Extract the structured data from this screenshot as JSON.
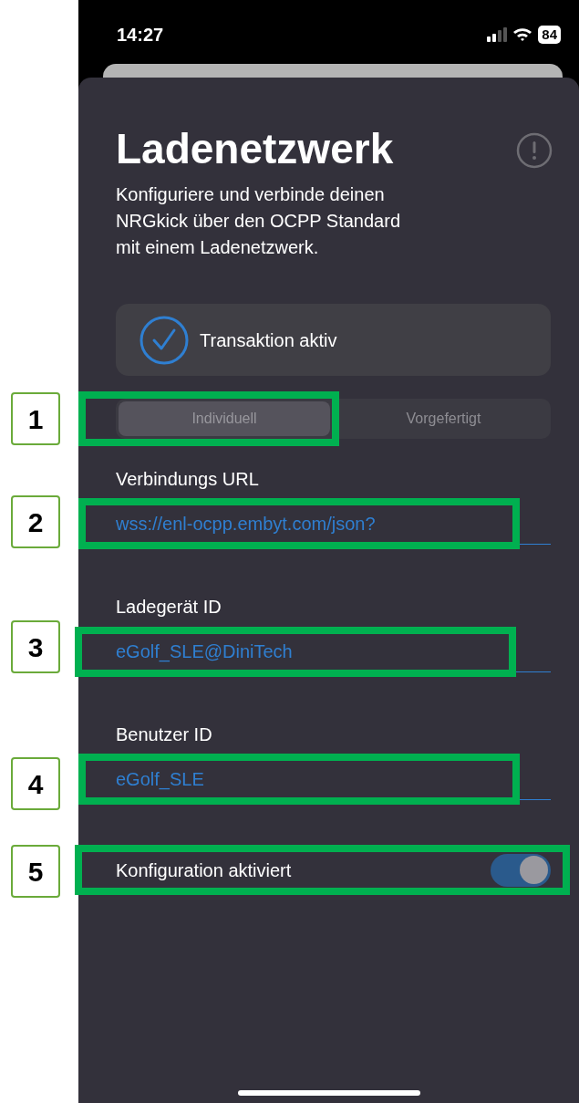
{
  "status_bar": {
    "time": "14:27",
    "battery": "84"
  },
  "sheet": {
    "title": "Ladenetzwerk",
    "description": "Konfiguriere und verbinde deinen NRGkick über den OCPP Standard mit einem Ladenetzwerk.",
    "status": {
      "label": "Transaktion aktiv",
      "checked": true
    },
    "segments": [
      {
        "label": "Individuell",
        "selected": true
      },
      {
        "label": "Vorgefertigt",
        "selected": false
      }
    ],
    "fields": [
      {
        "label": "Verbindungs URL",
        "value": "wss://enl-ocpp.embyt.com/json?"
      },
      {
        "label": "Ladegerät ID",
        "value": "eGolf_SLE@DiniTech"
      },
      {
        "label": "Benutzer ID",
        "value": "eGolf_SLE"
      }
    ],
    "toggle": {
      "label": "Konfiguration aktiviert",
      "on": true
    }
  },
  "annotations": [
    {
      "number": "1"
    },
    {
      "number": "2"
    },
    {
      "number": "3"
    },
    {
      "number": "4"
    },
    {
      "number": "5"
    }
  ]
}
